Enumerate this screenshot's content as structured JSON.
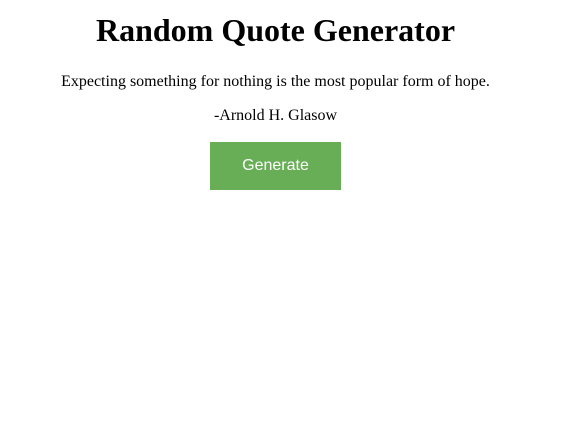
{
  "header": {
    "title": "Random Quote Generator"
  },
  "quote": {
    "text": "Expecting something for nothing is the most popular form of hope.",
    "author": "-Arnold H. Glasow"
  },
  "actions": {
    "generate_label": "Generate"
  },
  "colors": {
    "button_bg": "#67ae57",
    "button_text": "#ffffff",
    "text": "#000000",
    "background": "#ffffff"
  }
}
